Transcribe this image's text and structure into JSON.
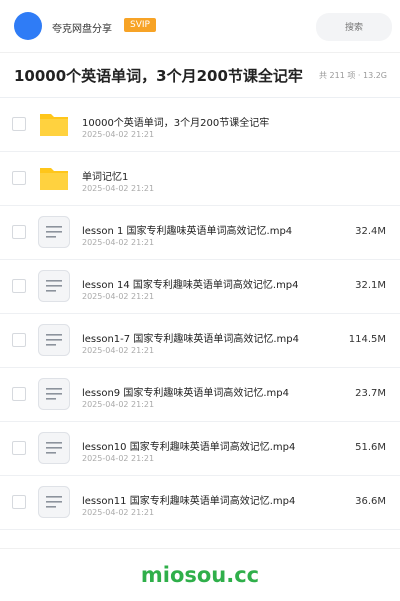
{
  "header": {
    "site_name": "夸克网盘分享",
    "vip_badge": "SVIP",
    "search_placeholder": "搜索"
  },
  "folder": {
    "title": "10000个英语单词，3个月200节课全记牢",
    "meta": "共 211 项 · 13.2G"
  },
  "items": [
    {
      "type": "folder",
      "name": "10000个英语单词，3个月200节课全记牢",
      "time": "2025-04-02 21:21",
      "size": ""
    },
    {
      "type": "folder",
      "name": "单词记忆1",
      "time": "2025-04-02 21:21",
      "size": ""
    },
    {
      "type": "file",
      "name": "lesson 1 国家专利趣味英语单词高效记忆.mp4",
      "time": "2025-04-02 21:21",
      "size": "32.4M"
    },
    {
      "type": "file",
      "name": "lesson 14 国家专利趣味英语单词高效记忆.mp4",
      "time": "2025-04-02 21:21",
      "size": "32.1M"
    },
    {
      "type": "file",
      "name": "lesson1-7 国家专利趣味英语单词高效记忆.mp4",
      "time": "2025-04-02 21:21",
      "size": "114.5M"
    },
    {
      "type": "file",
      "name": "lesson9 国家专利趣味英语单词高效记忆.mp4",
      "time": "2025-04-02 21:21",
      "size": "23.7M"
    },
    {
      "type": "file",
      "name": "lesson10 国家专利趣味英语单词高效记忆.mp4",
      "time": "2025-04-02 21:21",
      "size": "51.6M"
    },
    {
      "type": "file",
      "name": "lesson11 国家专利趣味英语单词高效记忆.mp4",
      "time": "2025-04-02 21:21",
      "size": "36.6M"
    }
  ],
  "watermark": "miosou.cc",
  "colors": {
    "avatar": "#2f7cf6",
    "vip": "#f7a326",
    "folder_icon": "#ffc61a",
    "watermark": "#2faf4a"
  }
}
